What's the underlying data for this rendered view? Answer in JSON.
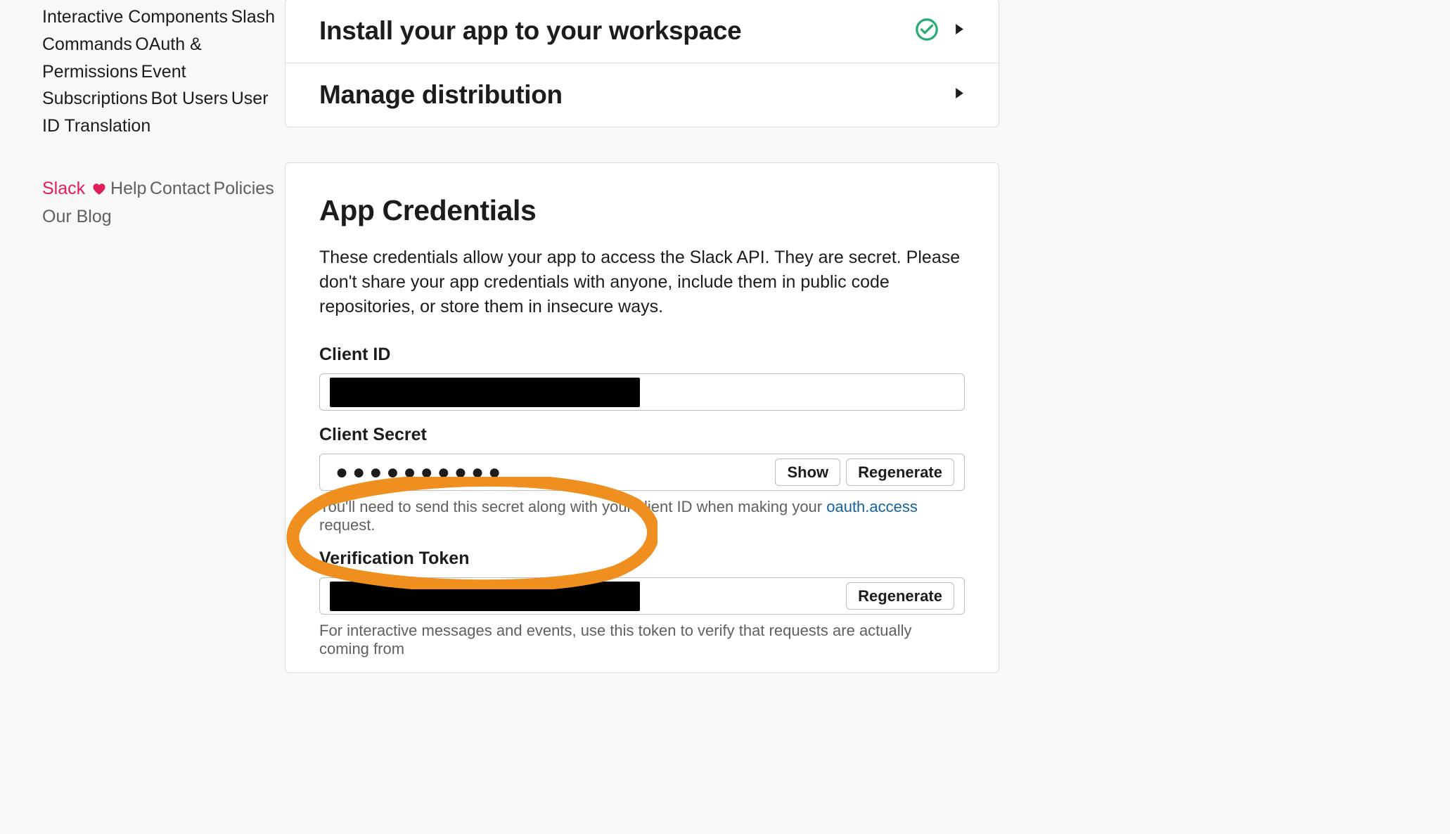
{
  "sidebar": {
    "nav_items": [
      "Interactive Components",
      "Slash Commands",
      "OAuth & Permissions",
      "Event Subscriptions",
      "Bot Users",
      "User ID Translation"
    ],
    "footer_items": {
      "slack": "Slack",
      "help": "Help",
      "contact": "Contact",
      "policies": "Policies",
      "blog": "Our Blog"
    }
  },
  "setup": {
    "install_title": "Install your app to your workspace",
    "distribution_title": "Manage distribution"
  },
  "credentials": {
    "title": "App Credentials",
    "description": "These credentials allow your app to access the Slack API. They are secret. Please don't share your app credentials with anyone, include them in public code repositories, or store them in insecure ways.",
    "client_id_label": "Client ID",
    "client_secret_label": "Client Secret",
    "client_secret_masked": "●●●●●●●●●●",
    "show_button": "Show",
    "regenerate_button": "Regenerate",
    "client_secret_hint_prefix": "You'll need to send this secret along with your client ID when making your ",
    "client_secret_hint_link": "oauth.access",
    "client_secret_hint_suffix": " request.",
    "verification_token_label": "Verification Token",
    "verification_hint": "For interactive messages and events, use this token to verify that requests are actually coming from"
  }
}
